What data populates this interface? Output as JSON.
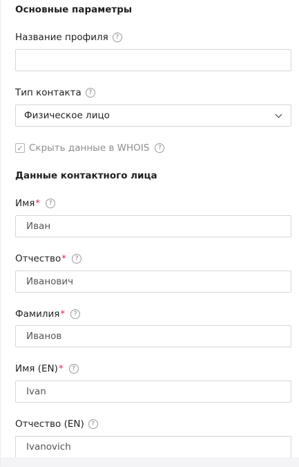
{
  "basic_params": {
    "title": "Основные параметры",
    "profile_name_label": "Название профиля",
    "profile_name_value": "",
    "contact_type_label": "Тип контакта",
    "contact_type_value": "Физическое лицо",
    "hide_whois_label": "Скрыть данные в WHOIS",
    "hide_whois_checked": true
  },
  "contact_person": {
    "title": "Данные контактного лица",
    "required_mark": "*",
    "fields": [
      {
        "label": "Имя",
        "required": true,
        "value": "Иван"
      },
      {
        "label": "Отчество",
        "required": true,
        "value": "Иванович"
      },
      {
        "label": "Фамилия",
        "required": true,
        "value": "Иванов"
      },
      {
        "label": "Имя (EN)",
        "required": true,
        "value": "Ivan"
      },
      {
        "label": "Отчество (EN)",
        "required": false,
        "value": "Ivanovich"
      }
    ]
  },
  "icons": {
    "help": "question-circle-icon",
    "chevron": "chevron-down-icon",
    "check": "checkmark-icon"
  },
  "colors": {
    "required": "#e0245e",
    "border": "#d6d6d6",
    "muted_text": "#8d8d8d"
  }
}
